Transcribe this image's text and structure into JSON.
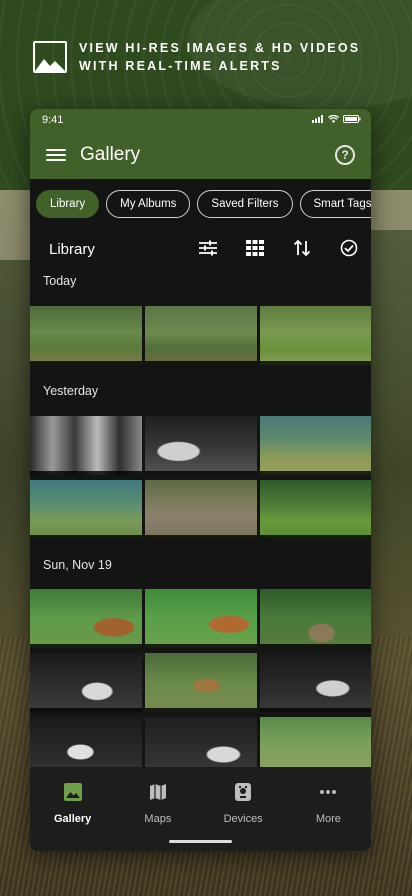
{
  "promo": {
    "headline_line1": "VIEW HI-RES IMAGES & HD VIDEOS",
    "headline_line2": "WITH REAL-TIME ALERTS",
    "icon": "image-icon"
  },
  "status_bar": {
    "time": "9:41"
  },
  "app": {
    "title": "Gallery",
    "help_icon": "help-icon",
    "menu_icon": "hamburger-menu-icon"
  },
  "chips": [
    {
      "label": "Library",
      "active": true
    },
    {
      "label": "My Albums",
      "active": false
    },
    {
      "label": "Saved Filters",
      "active": false
    },
    {
      "label": "Smart Tags",
      "active": false
    }
  ],
  "library": {
    "title": "Library",
    "tools": [
      "filter-sliders-icon",
      "grid-view-icon",
      "sort-icon",
      "select-check-icon"
    ]
  },
  "sections": [
    {
      "label": "Today"
    },
    {
      "label": "Yesterday"
    },
    {
      "label": "Sun, Nov 19"
    }
  ],
  "bottom_nav": [
    {
      "label": "Gallery",
      "icon": "gallery-icon",
      "active": true
    },
    {
      "label": "Maps",
      "icon": "map-icon",
      "active": false
    },
    {
      "label": "Devices",
      "icon": "camera-device-icon",
      "active": false
    },
    {
      "label": "More",
      "icon": "more-dots-icon",
      "active": false
    }
  ],
  "colors": {
    "brand_green": "#41602a",
    "app_background": "#141414",
    "nav_background": "#1d1d1d"
  }
}
